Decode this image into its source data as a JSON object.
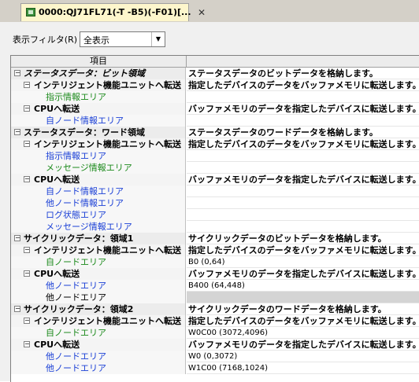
{
  "tab": {
    "title": "0000:QJ71FL71(-T -B5)(-F01)[...",
    "close_glyph": "✕",
    "icon": "module-icon"
  },
  "filter": {
    "label": "表示フィルタ(R)",
    "value": "全表示",
    "arrow": "▼"
  },
  "grid": {
    "header": "項目",
    "rows": [
      {
        "level": 1,
        "toggle": "−",
        "label": "ステータスデータ：ビット領域",
        "desc": "ステータスデータのビットデータを格納します。",
        "italic": true
      },
      {
        "level": 2,
        "toggle": "−",
        "label": "インテリジェント機能ユニットへ転送",
        "desc": "指定したデバイスのデータをバッファメモリに転送します。"
      },
      {
        "level": 3,
        "toggle": "",
        "label": "指示情報エリア",
        "desc": "",
        "color": "green"
      },
      {
        "level": 2,
        "toggle": "−",
        "label": "CPUへ転送",
        "desc": "バッファメモリのデータを指定したデバイスに転送します。"
      },
      {
        "level": 3,
        "toggle": "",
        "label": "自ノード情報エリア",
        "desc": "",
        "color": "blue"
      },
      {
        "level": 1,
        "toggle": "−",
        "label": "ステータスデータ：ワード領域",
        "desc": "ステータスデータのワードデータを格納します。"
      },
      {
        "level": 2,
        "toggle": "−",
        "label": "インテリジェント機能ユニットへ転送",
        "desc": "指定したデバイスのデータをバッファメモリに転送します。"
      },
      {
        "level": 3,
        "toggle": "",
        "label": "指示情報エリア",
        "desc": "",
        "color": "blue"
      },
      {
        "level": 3,
        "toggle": "",
        "label": "メッセージ情報エリア",
        "desc": "",
        "color": "green"
      },
      {
        "level": 2,
        "toggle": "−",
        "label": "CPUへ転送",
        "desc": "バッファメモリのデータを指定したデバイスに転送します。"
      },
      {
        "level": 3,
        "toggle": "",
        "label": "自ノード情報エリア",
        "desc": "",
        "color": "blue"
      },
      {
        "level": 3,
        "toggle": "",
        "label": "他ノード情報エリア",
        "desc": "",
        "color": "blue"
      },
      {
        "level": 3,
        "toggle": "",
        "label": "ログ状態エリア",
        "desc": "",
        "color": "blue"
      },
      {
        "level": 3,
        "toggle": "",
        "label": "メッセージ情報エリア",
        "desc": "",
        "color": "blue"
      },
      {
        "level": 1,
        "toggle": "−",
        "label": "サイクリックデータ：領域1",
        "desc": "サイクリックデータのビットデータを格納します。"
      },
      {
        "level": 2,
        "toggle": "−",
        "label": "インテリジェント機能ユニットへ転送",
        "desc": "指定したデバイスのデータをバッファメモリに転送します。"
      },
      {
        "level": 3,
        "toggle": "",
        "label": "自ノードエリア",
        "desc": "B0 (0,64)",
        "color": "green",
        "plain": true
      },
      {
        "level": 2,
        "toggle": "−",
        "label": "CPUへ転送",
        "desc": "バッファメモリのデータを指定したデバイスに転送します。"
      },
      {
        "level": 3,
        "toggle": "",
        "label": "他ノードエリア",
        "desc": "B400 (64,448)",
        "color": "blue",
        "plain": true
      },
      {
        "level": 3,
        "toggle": "",
        "label": "他ノードエリア",
        "desc": "",
        "color": "black",
        "gray": true
      },
      {
        "level": 1,
        "toggle": "−",
        "label": "サイクリックデータ：領域2",
        "desc": "サイクリックデータのワードデータを格納します。"
      },
      {
        "level": 2,
        "toggle": "−",
        "label": "インテリジェント機能ユニットへ転送",
        "desc": "指定したデバイスのデータをバッファメモリに転送します。"
      },
      {
        "level": 3,
        "toggle": "",
        "label": "自ノードエリア",
        "desc": "W0C00 (3072,4096)",
        "color": "green",
        "plain": true
      },
      {
        "level": 2,
        "toggle": "−",
        "label": "CPUへ転送",
        "desc": "バッファメモリのデータを指定したデバイスに転送します。"
      },
      {
        "level": 3,
        "toggle": "",
        "label": "他ノードエリア",
        "desc": "W0 (0,3072)",
        "color": "blue",
        "plain": true
      },
      {
        "level": 3,
        "toggle": "",
        "label": "他ノードエリア",
        "desc": "W1C00 (7168,1024)",
        "color": "blue",
        "plain": true
      }
    ]
  }
}
